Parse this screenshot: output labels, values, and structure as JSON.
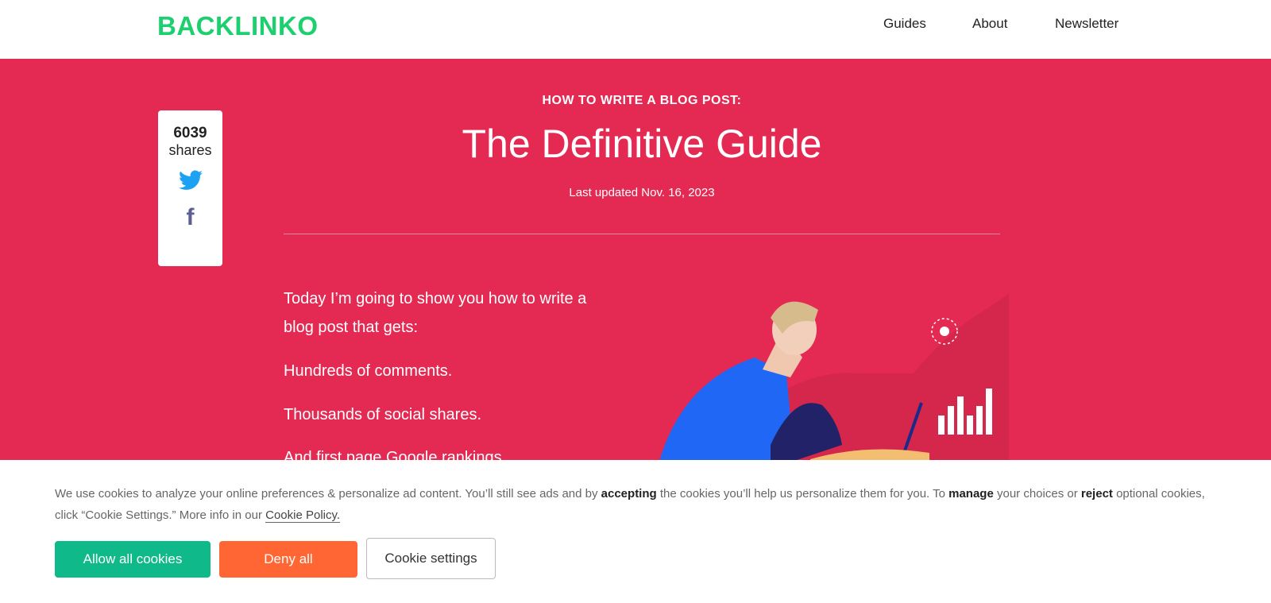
{
  "header": {
    "logo": "BACKLINKO",
    "nav": [
      "Guides",
      "About",
      "Newsletter"
    ]
  },
  "hero": {
    "kicker": "HOW TO WRITE A BLOG POST:",
    "title": "The Definitive Guide",
    "updated": "Last updated Nov. 16, 2023"
  },
  "share": {
    "count": "6039",
    "label": "shares",
    "icons": [
      "twitter-icon",
      "facebook-icon"
    ]
  },
  "intro": [
    "Today I’m going to show you how to write a",
    "blog post that gets:",
    "Hundreds of comments.",
    "Thousands of social shares.",
    "And first page Google rankings."
  ],
  "cookie": {
    "t1": "We use cookies to analyze your online preferences & personalize ad content. You’ll still see ads and by ",
    "b1": "accepting",
    "t2": " the cookies you’ll help us personalize them for you. To ",
    "b2": "manage",
    "t3": " your choices or ",
    "b3": "reject",
    "t4": " optional cookies, click “Cookie Settings.” More info in our ",
    "link": "Cookie Policy.",
    "allow": "Allow all cookies",
    "deny": "Deny all",
    "settings": "Cookie settings"
  },
  "colors": {
    "brand": "#1ccf6f",
    "hero": "#e42a53",
    "allow": "#10b98a",
    "deny": "#ff6633"
  }
}
